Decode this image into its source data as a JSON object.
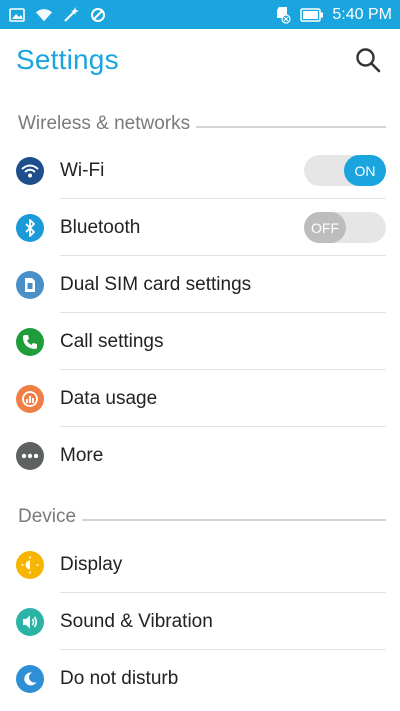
{
  "status_bar": {
    "time": "5:40 PM",
    "icons": [
      "image-icon",
      "wifi-icon",
      "magic-wand-icon",
      "blocked-icon",
      "sd-card-icon",
      "battery-icon"
    ]
  },
  "app_bar": {
    "title": "Settings",
    "search_icon": "search-icon"
  },
  "sections": {
    "wireless": {
      "label": "Wireless & networks"
    },
    "device": {
      "label": "Device"
    }
  },
  "wireless_items": [
    {
      "label": "Wi-Fi",
      "icon": "wifi-icon",
      "color": "#1f4e8c",
      "toggle": "ON"
    },
    {
      "label": "Bluetooth",
      "icon": "bluetooth-icon",
      "color": "#1a9ad6",
      "toggle": "OFF"
    },
    {
      "label": "Dual SIM card settings",
      "icon": "sim-card-icon",
      "color": "#4a90c8"
    },
    {
      "label": "Call settings",
      "icon": "phone-icon",
      "color": "#1e9d3a"
    },
    {
      "label": "Data usage",
      "icon": "data-usage-icon",
      "color": "#f07e45"
    },
    {
      "label": "More",
      "icon": "more-icon",
      "color": "#5d6160"
    }
  ],
  "device_items": [
    {
      "label": "Display",
      "icon": "display-icon",
      "color": "#f7b500"
    },
    {
      "label": "Sound & Vibration",
      "icon": "sound-icon",
      "color": "#2bb3a6"
    },
    {
      "label": "Do not disturb",
      "icon": "moon-icon",
      "color": "#2f8fd6"
    }
  ],
  "colors": {
    "accent": "#1aa5de",
    "section_text": "#7a7a7a",
    "toggle_on": "#1aa5de",
    "toggle_off": "#bdbdbd"
  }
}
